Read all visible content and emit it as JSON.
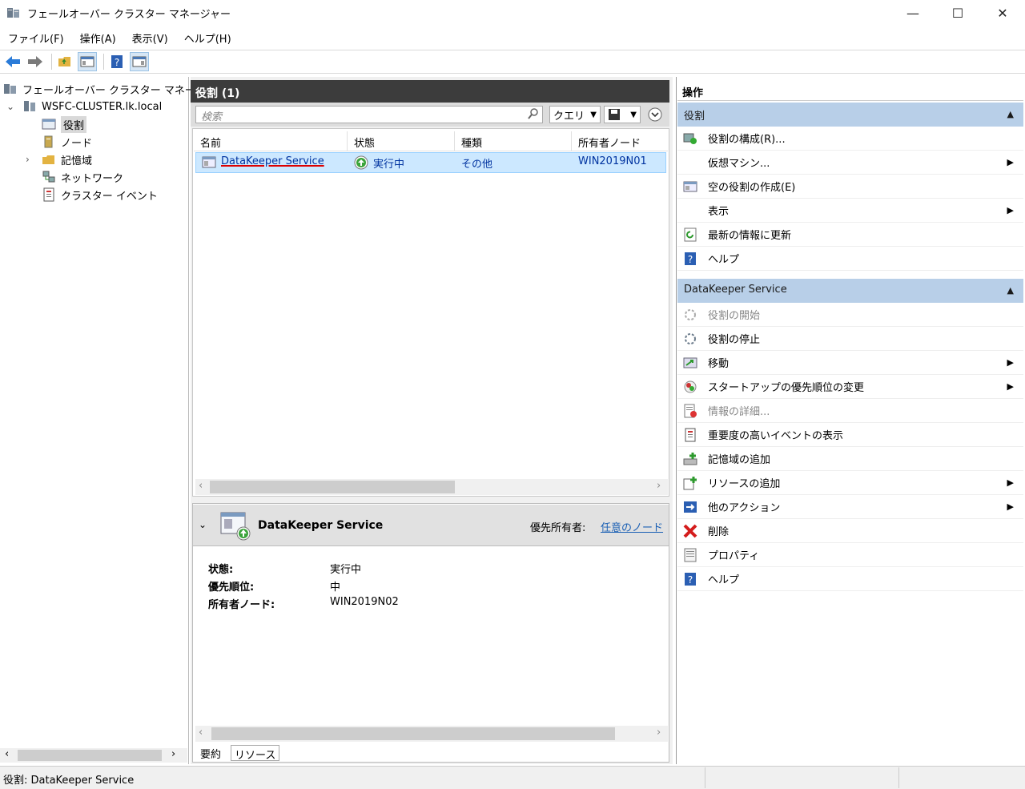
{
  "window": {
    "title": "フェールオーバー クラスター マネージャー",
    "min": "—",
    "max": "☐",
    "close": "✕"
  },
  "menu": [
    "ファイル(F)",
    "操作(A)",
    "表示(V)",
    "ヘルプ(H)"
  ],
  "tree": {
    "root": "フェールオーバー クラスター マネージャー",
    "cluster": "WSFC-CLUSTER.lk.local",
    "items": [
      "役割",
      "ノード",
      "記憶域",
      "ネットワーク",
      "クラスター イベント"
    ]
  },
  "roles": {
    "header": "役割 (1)",
    "search_placeholder": "検索",
    "query_label": "クエリ",
    "columns": [
      "名前",
      "状態",
      "種類",
      "所有者ノード"
    ],
    "row": {
      "name": "DataKeeper Service",
      "status": "実行中",
      "type": "その他",
      "owner": "WIN2019N01"
    }
  },
  "detail": {
    "title": "DataKeeper Service",
    "preferred_owner_label": "優先所有者:",
    "preferred_owner_link": "任意のノード",
    "fields": [
      {
        "k": "状態:",
        "v": "実行中"
      },
      {
        "k": "優先順位:",
        "v": "中"
      },
      {
        "k": "所有者ノード:",
        "v": "WIN2019N02"
      }
    ],
    "tabs": [
      "要約",
      "リソース"
    ]
  },
  "actions": {
    "title": "操作",
    "group1": "役割",
    "group1_items": [
      {
        "label": "役割の構成(R)...",
        "icon": "configure-icon"
      },
      {
        "label": "仮想マシン...",
        "icon": "",
        "submenu": true
      },
      {
        "label": "空の役割の作成(E)",
        "icon": "empty-role-icon"
      },
      {
        "label": "表示",
        "icon": "",
        "submenu": true
      },
      {
        "label": "最新の情報に更新",
        "icon": "refresh-icon"
      },
      {
        "label": "ヘルプ",
        "icon": "help-icon"
      }
    ],
    "group2": "DataKeeper Service",
    "group2_items": [
      {
        "label": "役割の開始",
        "icon": "start-icon",
        "disabled": true
      },
      {
        "label": "役割の停止",
        "icon": "stop-icon"
      },
      {
        "label": "移動",
        "icon": "move-icon",
        "submenu": true
      },
      {
        "label": "スタートアップの優先順位の変更",
        "icon": "priority-icon",
        "submenu": true
      },
      {
        "label": "情報の詳細...",
        "icon": "info-icon",
        "disabled": true
      },
      {
        "label": "重要度の高いイベントの表示",
        "icon": "events-icon"
      },
      {
        "label": "記憶域の追加",
        "icon": "add-storage-icon"
      },
      {
        "label": "リソースの追加",
        "icon": "add-resource-icon",
        "submenu": true
      },
      {
        "label": "他のアクション",
        "icon": "more-actions-icon",
        "submenu": true
      },
      {
        "label": "削除",
        "icon": "delete-icon"
      },
      {
        "label": "プロパティ",
        "icon": "properties-icon"
      },
      {
        "label": "ヘルプ",
        "icon": "help-icon"
      }
    ]
  },
  "status_bar": "役割: DataKeeper Service"
}
